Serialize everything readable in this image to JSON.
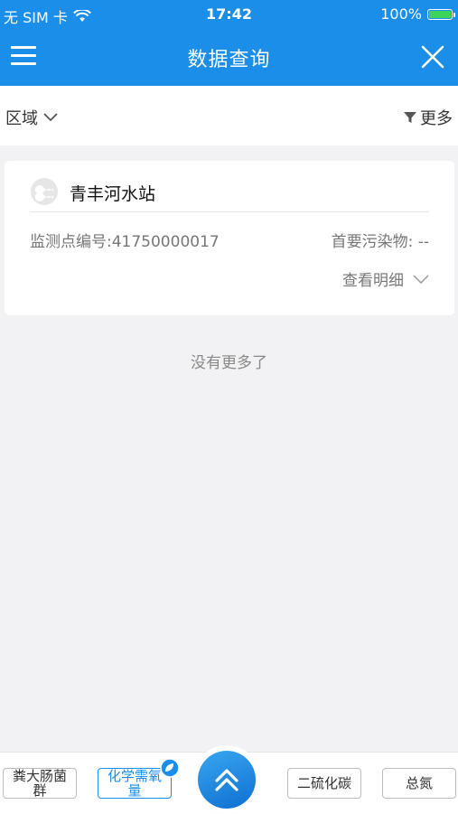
{
  "status_bar": {
    "carrier": "无 SIM 卡",
    "time": "17:42",
    "battery": "100%",
    "battery_level": 1.0,
    "battery_color": "#3ed35a"
  },
  "nav": {
    "title": "数据查询",
    "menu_icon": "hamburger-menu-icon",
    "close_icon": "close-icon"
  },
  "filter": {
    "region_label": "区域",
    "more_label": "更多"
  },
  "station_card": {
    "name": "青丰河水站",
    "point_code": "监测点编号:41750000017",
    "primary_pollutant": "首要污染物: --",
    "detail_label": "查看明细"
  },
  "list_end_text": "没有更多了",
  "bottom_bar": {
    "chips": [
      {
        "label_line1": "粪大肠菌",
        "label_line2": "群",
        "active": false
      },
      {
        "label_line1": "化学需氧",
        "label_line2": "量",
        "active": true
      },
      {
        "label": "二硫化碳",
        "active": false
      },
      {
        "label": "总氮",
        "active": false
      }
    ],
    "fab_icon": "double-chevron-up-icon"
  },
  "colors": {
    "primary": "#1a8ee8",
    "background": "#f2f2f4",
    "muted_text": "#777777"
  }
}
